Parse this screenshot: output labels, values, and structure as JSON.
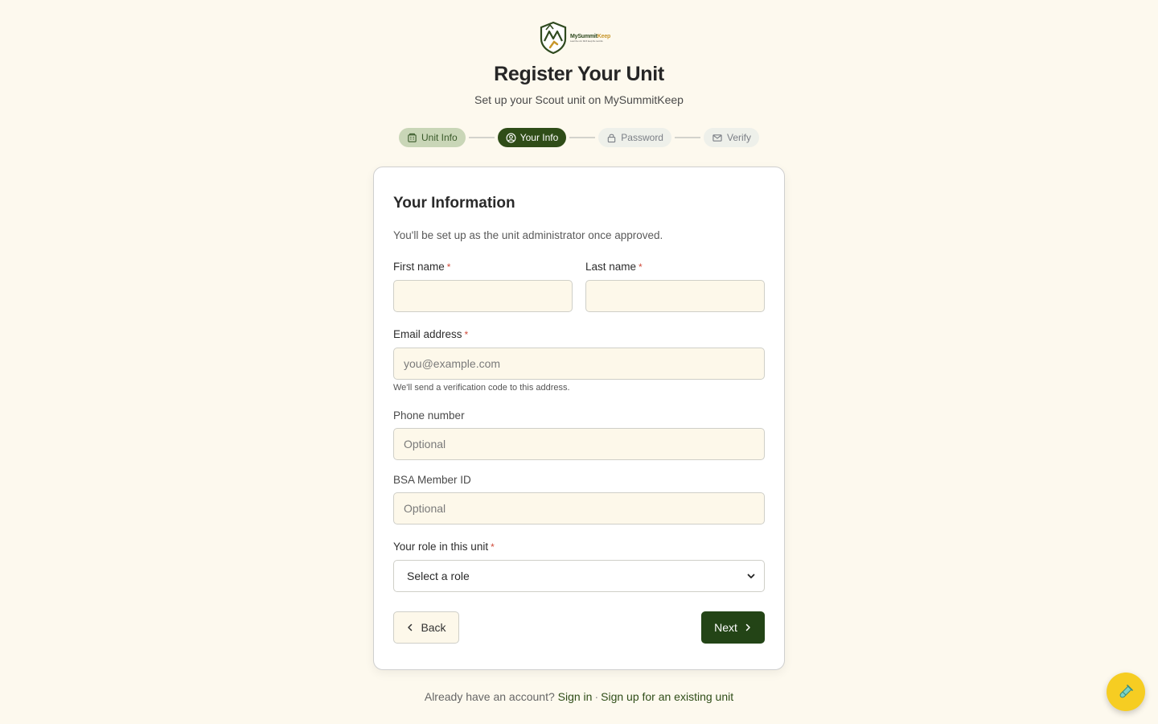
{
  "brand": {
    "name_part1": "MySummit",
    "name_part2": "Keep",
    "tagline": "Lead the unit. We'll keep the records."
  },
  "header": {
    "title": "Register Your Unit",
    "subtitle": "Set up your Scout unit on MySummitKeep"
  },
  "stepper": {
    "steps": [
      {
        "label": "Unit Info",
        "icon": "building-icon",
        "state": "done"
      },
      {
        "label": "Your Info",
        "icon": "user-circle-icon",
        "state": "active"
      },
      {
        "label": "Password",
        "icon": "lock-icon",
        "state": "todo"
      },
      {
        "label": "Verify",
        "icon": "mail-icon",
        "state": "todo"
      }
    ]
  },
  "form": {
    "title": "Your Information",
    "description": "You'll be set up as the unit administrator once approved.",
    "first_name": {
      "label": "First name",
      "value": "",
      "placeholder": ""
    },
    "last_name": {
      "label": "Last name",
      "value": "",
      "placeholder": ""
    },
    "email": {
      "label": "Email address",
      "value": "",
      "placeholder": "you@example.com",
      "hint": "We'll send a verification code to this address."
    },
    "phone": {
      "label": "Phone number",
      "value": "",
      "placeholder": "Optional"
    },
    "member_id": {
      "label": "BSA Member ID",
      "value": "",
      "placeholder": "Optional"
    },
    "role": {
      "label": "Your role in this unit",
      "selected": "Select a role"
    },
    "required_mark": "*",
    "back_label": "Back",
    "next_label": "Next"
  },
  "footer": {
    "prompt": "Already have an account?",
    "sign_in": "Sign in",
    "separator": "·",
    "existing_unit": "Sign up for an existing unit"
  },
  "colors": {
    "background": "#fdf9ee",
    "primary": "#2f4d18",
    "accent": "#c8962a",
    "required": "#d04a3a",
    "fab": "#f6cd22"
  },
  "fab": {
    "icon": "test-tube-icon"
  }
}
